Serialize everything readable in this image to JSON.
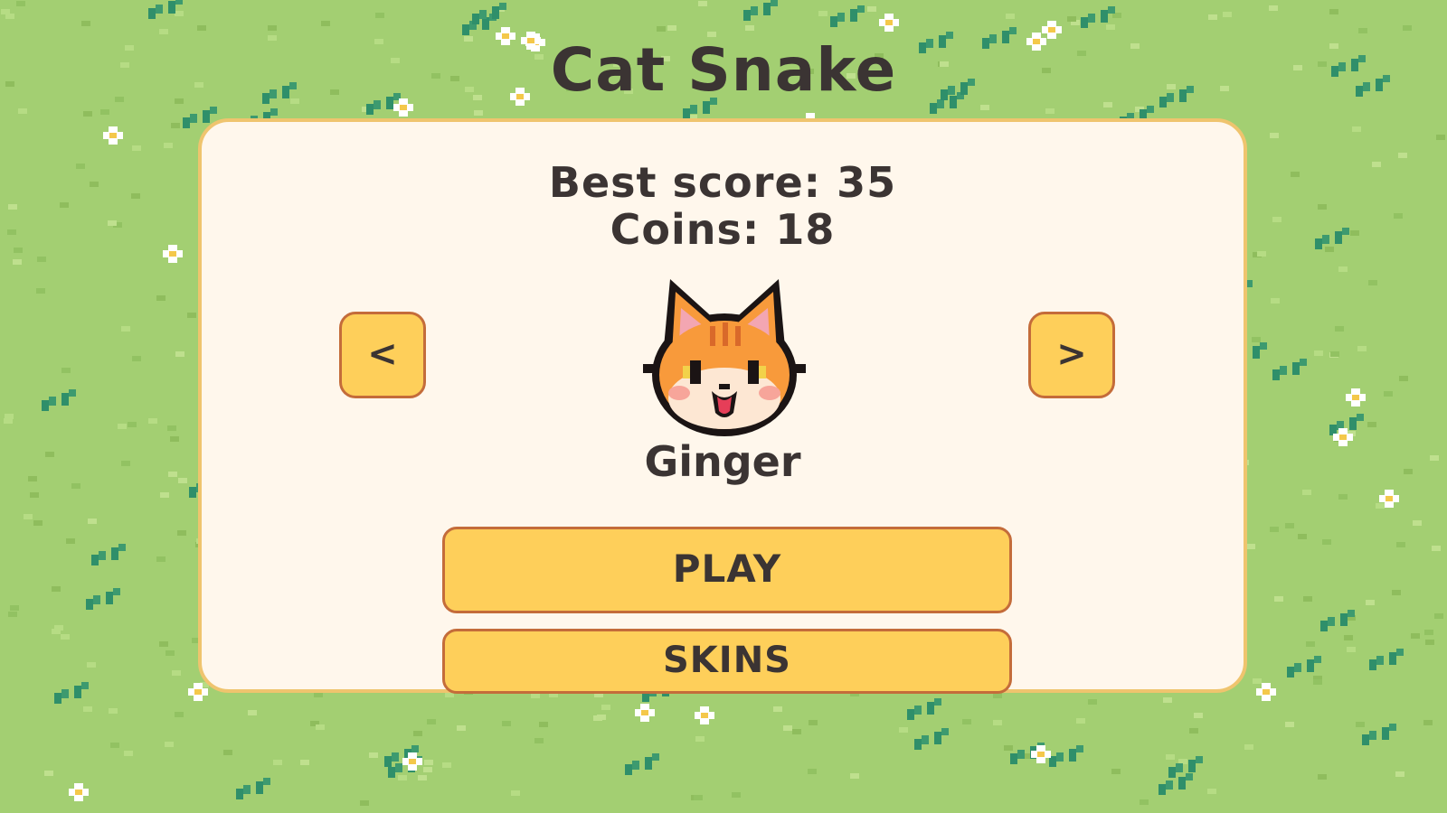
{
  "game": {
    "title": "Cat Snake"
  },
  "menu": {
    "best_score_text": "Best score: 35",
    "coins_text": "Coins: 18",
    "prev_skin_label": "<",
    "next_skin_label": ">",
    "selected_skin_name": "Ginger",
    "play_label": "PLAY",
    "skins_label": "SKINS"
  },
  "colors": {
    "grass": "#a3cf72",
    "panel": "#fff7ec",
    "panel_border": "#efc46e",
    "button": "#fecf5a",
    "button_border": "#c46c3a",
    "text": "#3b3433",
    "cat_orange": "#f89a3b"
  }
}
